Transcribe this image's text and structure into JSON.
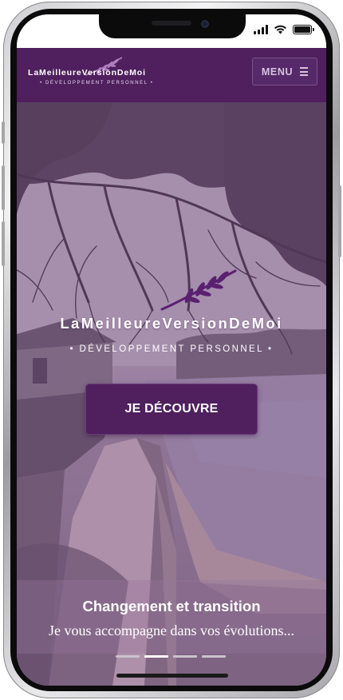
{
  "brand": {
    "name": "LaMeilleureVersionDeMoi",
    "tagline": "• DÉVELOPPEMENT PERSONNEL •"
  },
  "header": {
    "menu_label": "MENU",
    "menu_icon": "hamburger-icon"
  },
  "hero": {
    "title": "LaMeilleureVersionDeMoi",
    "subtitle": "• DÉVELOPPEMENT PERSONNEL •",
    "cta_label": "JE DÉCOUVRE",
    "caption_title": "Changement et transition",
    "caption_text": "Je vous accompagne dans vos évolutions...",
    "slides_total": 4,
    "active_slide": 2
  },
  "statusbar": {
    "icons": [
      "signal-icon",
      "wifi-icon",
      "battery-icon"
    ]
  },
  "colors": {
    "brand_purple": "#4f1f5e",
    "leaf_purple": "#5a2070",
    "white": "#ffffff"
  }
}
